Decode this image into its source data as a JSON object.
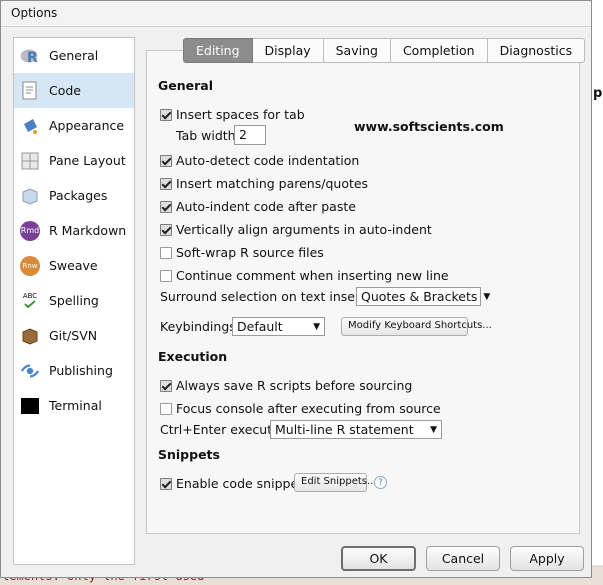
{
  "window": {
    "title": "Options"
  },
  "background": {
    "code_text": "lements: only the first used",
    "right_glyph": "p"
  },
  "sidebar": {
    "items": [
      {
        "label": "General",
        "icon": "r-logo-icon"
      },
      {
        "label": "Code",
        "icon": "code-page-icon",
        "active": true
      },
      {
        "label": "Appearance",
        "icon": "paint-bucket-icon"
      },
      {
        "label": "Pane Layout",
        "icon": "pane-grid-icon"
      },
      {
        "label": "Packages",
        "icon": "package-box-icon"
      },
      {
        "label": "R Markdown",
        "icon": "rmd-icon",
        "icon_text": "Rmd"
      },
      {
        "label": "Sweave",
        "icon": "sweave-icon",
        "icon_text": "Rnw"
      },
      {
        "label": "Spelling",
        "icon": "spellcheck-icon",
        "icon_text": "ABC"
      },
      {
        "label": "Git/SVN",
        "icon": "git-box-icon"
      },
      {
        "label": "Publishing",
        "icon": "publish-icon"
      },
      {
        "label": "Terminal",
        "icon": "terminal-icon"
      }
    ]
  },
  "tabs": [
    "Editing",
    "Display",
    "Saving",
    "Completion",
    "Diagnostics"
  ],
  "active_tab": "Editing",
  "general": {
    "heading": "General",
    "insert_spaces": {
      "label": "Insert spaces for tab",
      "checked": true
    },
    "tab_width": {
      "label": "Tab width",
      "value": "2"
    },
    "options": [
      {
        "label": "Auto-detect code indentation",
        "checked": true
      },
      {
        "label": "Insert matching parens/quotes",
        "checked": true
      },
      {
        "label": "Auto-indent code after paste",
        "checked": true
      },
      {
        "label": "Vertically align arguments in auto-indent",
        "checked": true
      },
      {
        "label": "Soft-wrap R source files",
        "checked": false
      },
      {
        "label": "Continue comment when inserting new line",
        "checked": false
      }
    ],
    "surround": {
      "label": "Surround selection on text insertion:",
      "value": "Quotes & Brackets"
    },
    "keybindings": {
      "label": "Keybindings:",
      "value": "Default"
    },
    "modify_shortcuts_label": "Modify Keyboard Shortcuts..."
  },
  "watermark": "www.softscients.com",
  "execution": {
    "heading": "Execution",
    "options": [
      {
        "label": "Always save R scripts before sourcing",
        "checked": true
      },
      {
        "label": "Focus console after executing from source",
        "checked": false
      }
    ],
    "ctrl_enter": {
      "label": "Ctrl+Enter executes:",
      "value": "Multi-line R statement"
    }
  },
  "snippets": {
    "heading": "Snippets",
    "enable": {
      "label": "Enable code snippets",
      "checked": true
    },
    "edit_label": "Edit Snippets...",
    "help_label": "?"
  },
  "buttons": {
    "ok": "OK",
    "cancel": "Cancel",
    "apply": "Apply"
  }
}
